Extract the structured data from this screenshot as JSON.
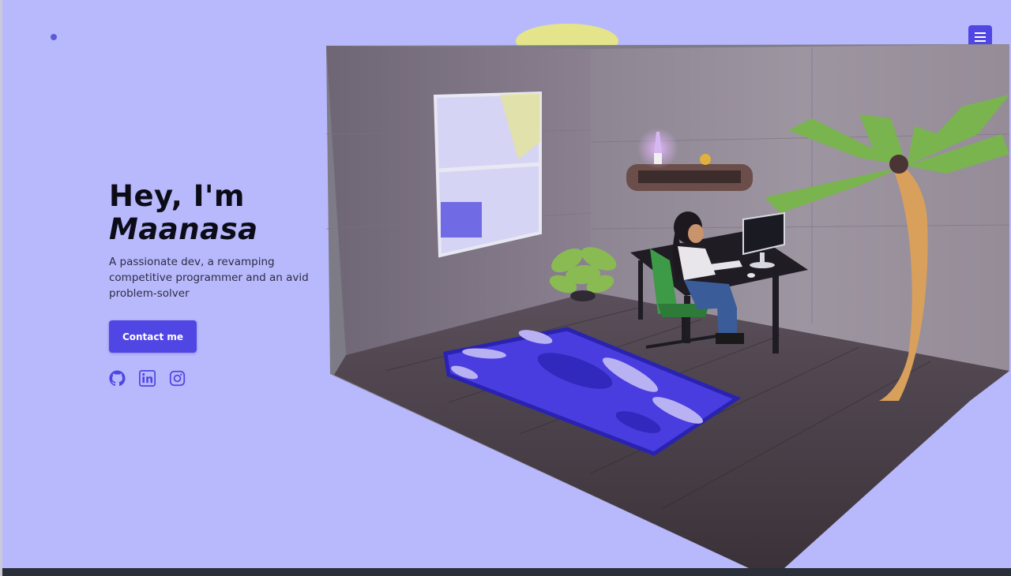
{
  "header": {
    "logo_icon": "dot-logo-icon",
    "menu_icon": "hamburger-menu-icon"
  },
  "hero": {
    "greeting": "Hey, I'm",
    "name": "Maanasa",
    "subtitle": "A passionate dev, a revamping competitive programmer and an avid problem-solver",
    "contact_label": "Contact me"
  },
  "social": [
    {
      "name": "github",
      "icon": "github-icon"
    },
    {
      "name": "linkedin",
      "icon": "linkedin-icon"
    },
    {
      "name": "instagram",
      "icon": "instagram-icon"
    }
  ],
  "scene": {
    "description_icon": "isometric-room-illustration"
  },
  "colors": {
    "background": "#b8b8fc",
    "accent": "#5046e4",
    "text": "#0c0c18"
  }
}
